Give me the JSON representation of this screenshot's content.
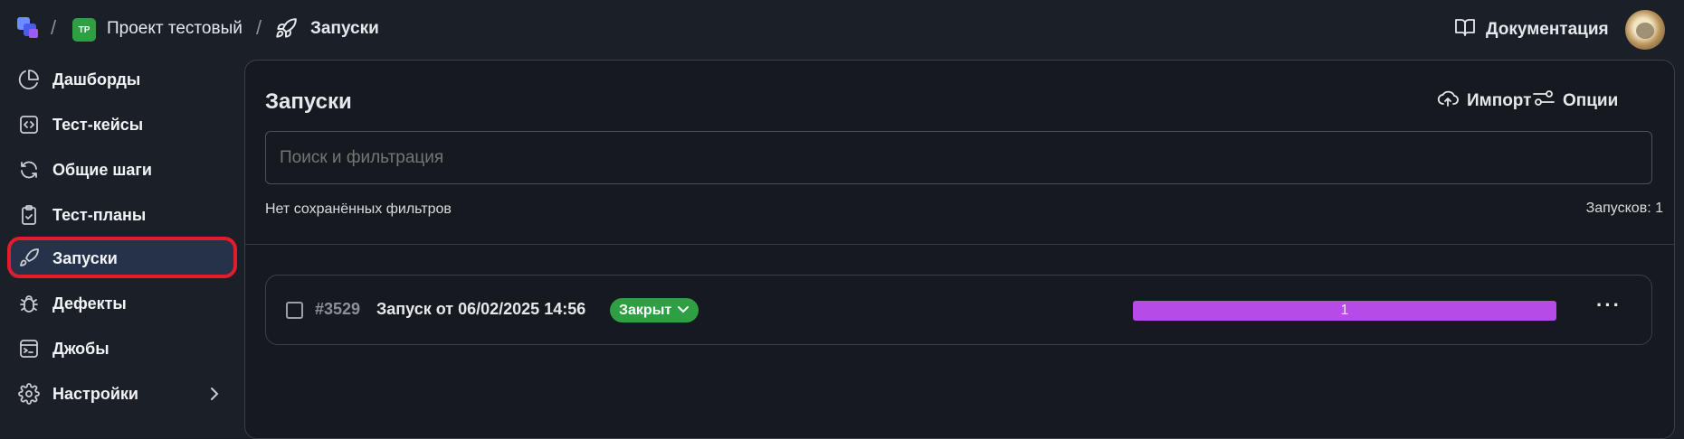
{
  "topbar": {
    "breadcrumb_sep": "/",
    "project_initials": "TP",
    "project_name": "Проект тестовый",
    "section_name": "Запуски",
    "docs_label": "Документация"
  },
  "sidebar": {
    "items": [
      {
        "label": "Дашборды",
        "icon": "pie-chart-icon"
      },
      {
        "label": "Тест-кейсы",
        "icon": "code-icon"
      },
      {
        "label": "Общие шаги",
        "icon": "refresh-icon"
      },
      {
        "label": "Тест-планы",
        "icon": "clipboard-check-icon"
      },
      {
        "label": "Запуски",
        "icon": "rocket-icon",
        "active": true
      },
      {
        "label": "Дефекты",
        "icon": "bug-icon"
      },
      {
        "label": "Джобы",
        "icon": "terminal-icon"
      },
      {
        "label": "Настройки",
        "icon": "gear-icon",
        "has_children": true
      }
    ]
  },
  "main": {
    "title": "Запуски",
    "import_label": "Импорт",
    "options_label": "Опции",
    "search_placeholder": "Поиск и фильтрация",
    "saved_filters_text": "Нет сохранённых фильтров",
    "runs_count_text": "Запусков: 1"
  },
  "runs": [
    {
      "id": "#3529",
      "name": "Запуск от 06/02/2025 14:56",
      "status": "Закрыт",
      "progress_value": "1",
      "progress_fraction": 1.0
    }
  ],
  "colors": {
    "accent_active": "#26324a",
    "status_closed": "#2ea043",
    "progress": "#b54ce8",
    "highlight": "#e31c2c"
  }
}
